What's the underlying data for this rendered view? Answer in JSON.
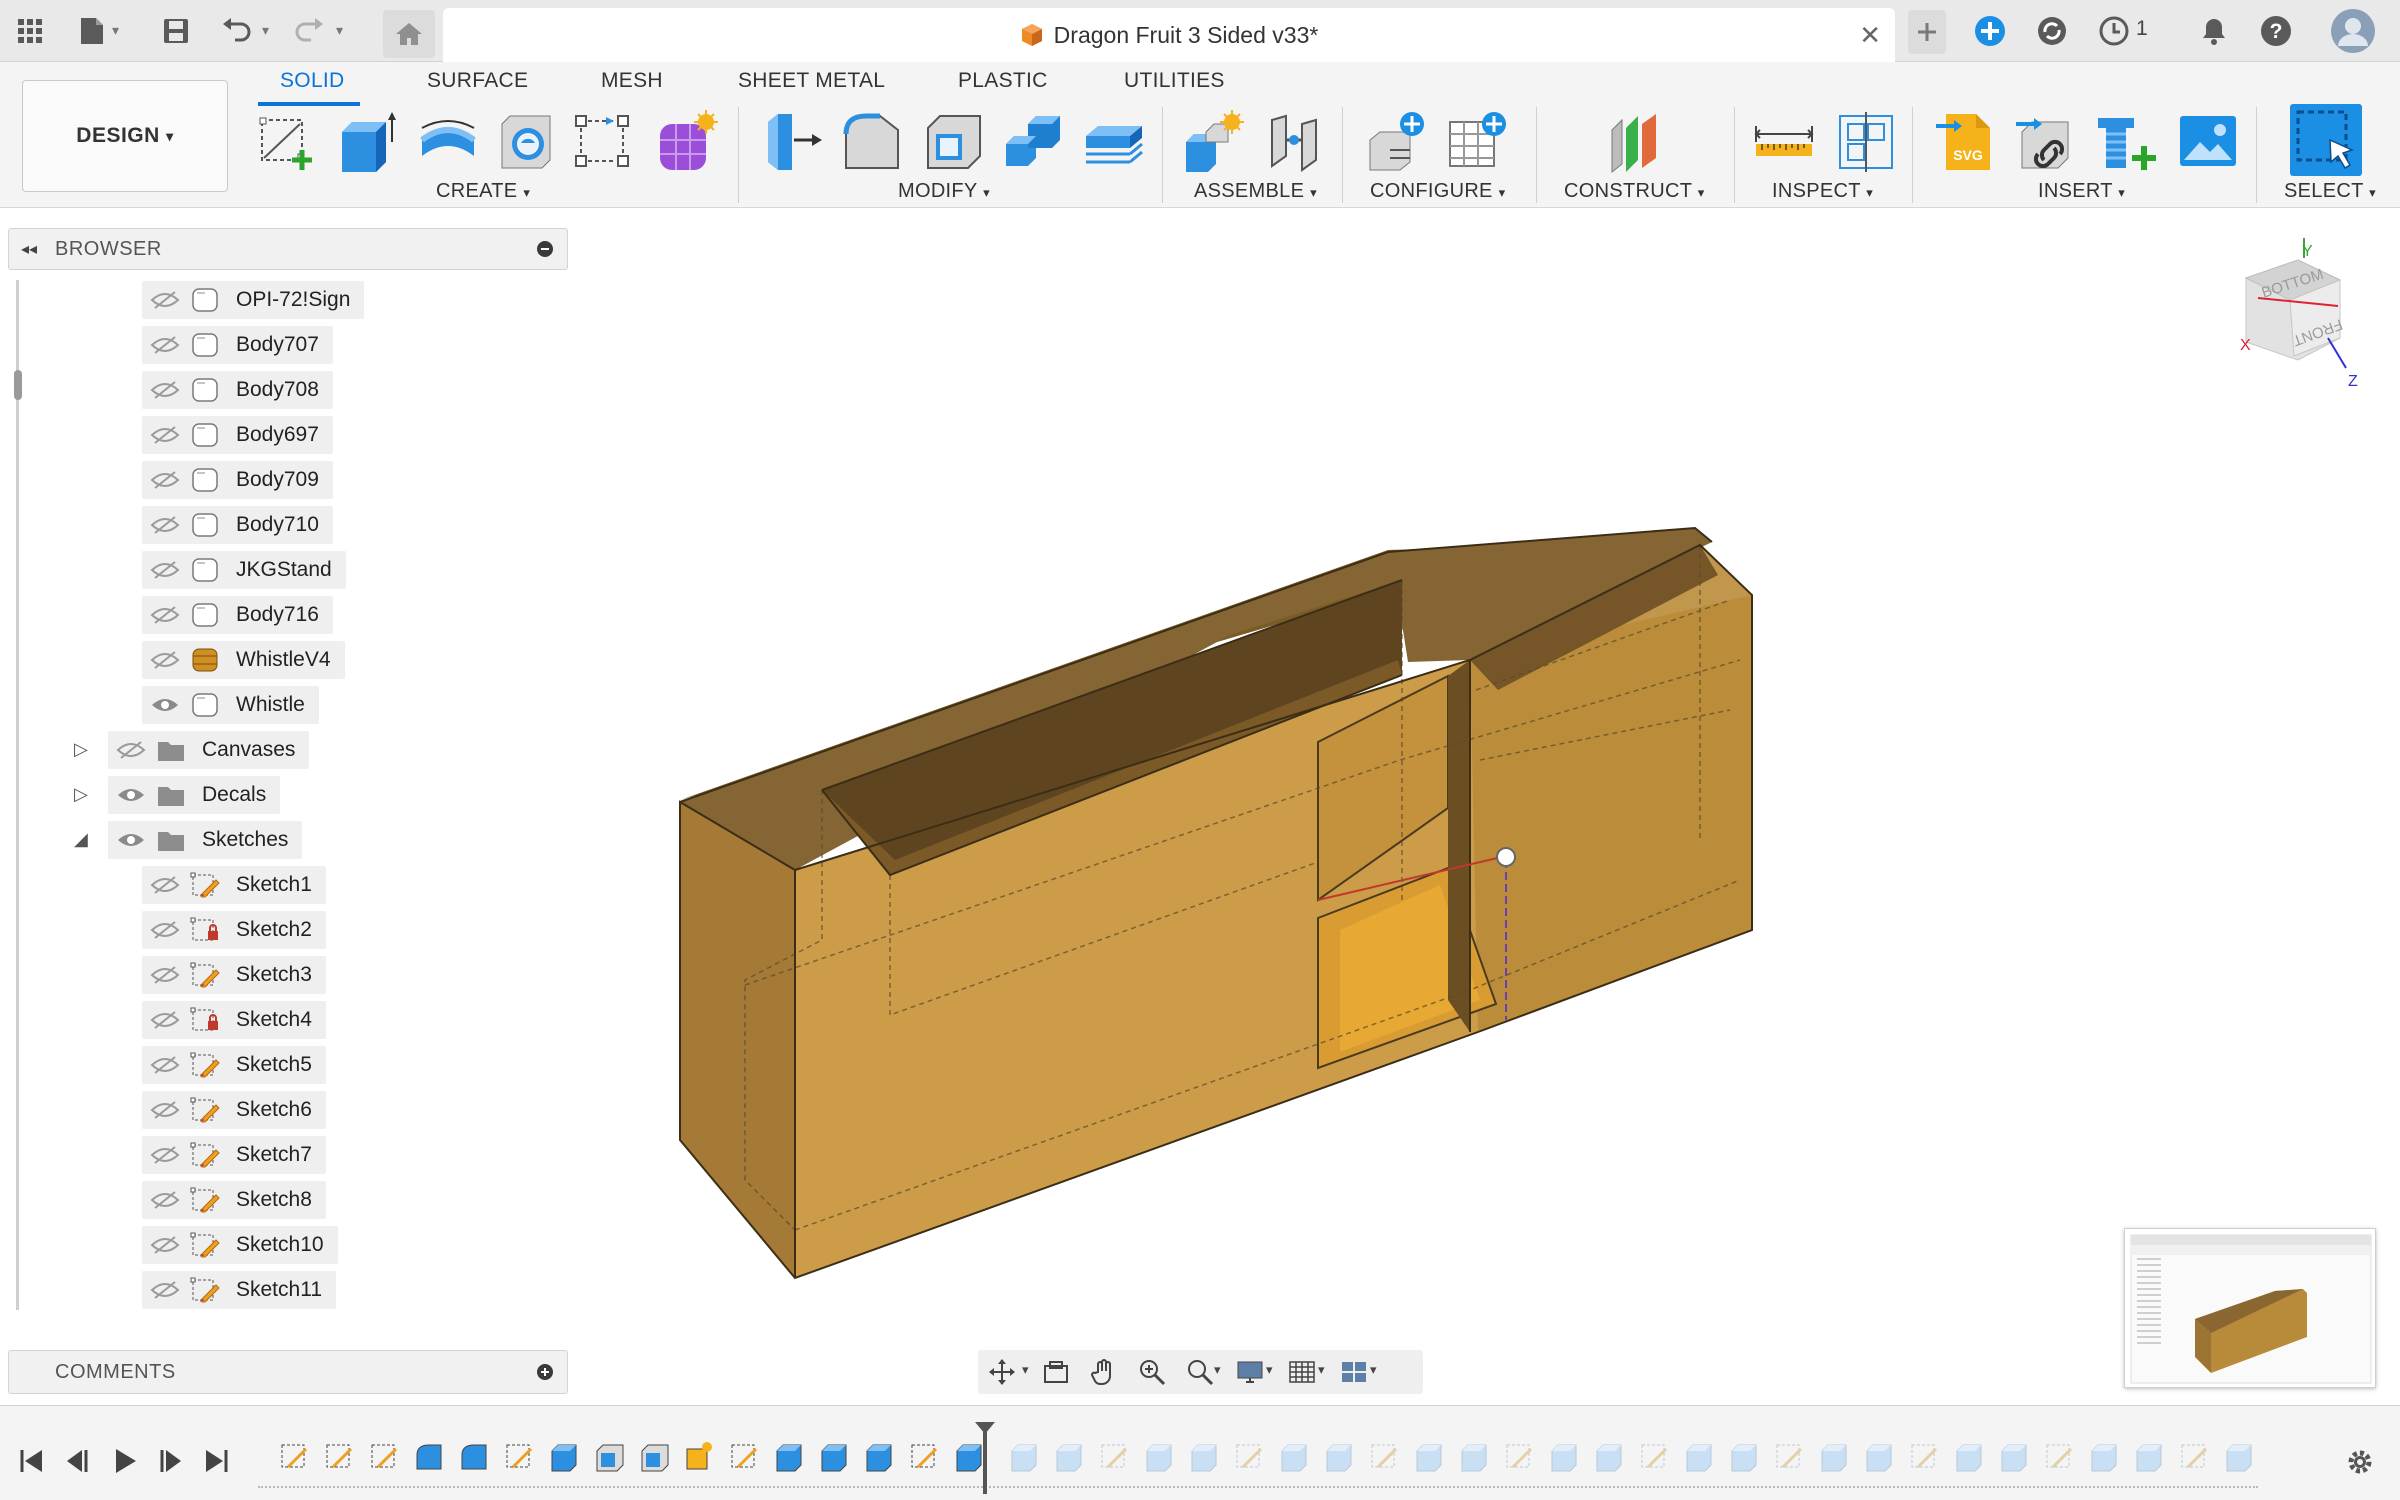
{
  "window": {
    "title": "Dragon Fruit 3 Sided v33*",
    "job_count": "1"
  },
  "toolbar": {
    "workspace": "DESIGN",
    "tabs": [
      {
        "label": "SOLID",
        "active": true
      },
      {
        "label": "SURFACE",
        "active": false
      },
      {
        "label": "MESH",
        "active": false
      },
      {
        "label": "SHEET METAL",
        "active": false
      },
      {
        "label": "PLASTIC",
        "active": false
      },
      {
        "label": "UTILITIES",
        "active": false
      }
    ],
    "groups": {
      "create": "CREATE",
      "modify": "MODIFY",
      "assemble": "ASSEMBLE",
      "configure": "CONFIGURE",
      "construct": "CONSTRUCT",
      "inspect": "INSPECT",
      "insert": "INSERT",
      "select": "SELECT"
    },
    "tools": {
      "create": [
        "create-sketch-icon",
        "extrude-icon",
        "revolve-icon",
        "hole-icon",
        "pattern-icon",
        "create-form-icon"
      ],
      "modify": [
        "press-pull-icon",
        "fillet-icon",
        "shell-icon",
        "combine-icon",
        "offset-face-icon"
      ],
      "assemble": [
        "new-component-icon",
        "joint-icon"
      ],
      "configure": [
        "configure-rule-icon",
        "configure-table-icon"
      ],
      "construct": [
        "offset-plane-icon"
      ],
      "inspect": [
        "measure-icon",
        "section-analysis-icon"
      ],
      "insert": [
        "insert-svg-icon",
        "insert-derive-icon",
        "insert-mcmaster-icon",
        "insert-canvas-icon"
      ],
      "select": [
        "select-window-icon"
      ]
    }
  },
  "browser": {
    "title": "BROWSER",
    "bodies": [
      {
        "name": "OPI-72!Sign",
        "visible": false
      },
      {
        "name": "Body707",
        "visible": false
      },
      {
        "name": "Body708",
        "visible": false
      },
      {
        "name": "Body697",
        "visible": false
      },
      {
        "name": "Body709",
        "visible": false
      },
      {
        "name": "Body710",
        "visible": false
      },
      {
        "name": "JKGStand",
        "visible": false
      },
      {
        "name": "Body716",
        "visible": false
      },
      {
        "name": "WhistleV4",
        "visible": false
      },
      {
        "name": "Whistle",
        "visible": true
      }
    ],
    "folders": [
      {
        "name": "Canvases",
        "visible": false,
        "expanded": false
      },
      {
        "name": "Decals",
        "visible": true,
        "expanded": false
      },
      {
        "name": "Sketches",
        "visible": true,
        "expanded": true
      }
    ],
    "sketches": [
      {
        "name": "Sketch1",
        "locked": false
      },
      {
        "name": "Sketch2",
        "locked": true
      },
      {
        "name": "Sketch3",
        "locked": false
      },
      {
        "name": "Sketch4",
        "locked": true
      },
      {
        "name": "Sketch5",
        "locked": false
      },
      {
        "name": "Sketch6",
        "locked": false
      },
      {
        "name": "Sketch7",
        "locked": false
      },
      {
        "name": "Sketch8",
        "locked": false
      },
      {
        "name": "Sketch10",
        "locked": false
      },
      {
        "name": "Sketch11",
        "locked": false
      }
    ]
  },
  "comments": {
    "title": "COMMENTS"
  },
  "viewcube": {
    "faces": [
      "BOTTOM",
      "FRONT"
    ],
    "axes": [
      "Y",
      "X",
      "Z"
    ]
  },
  "colors": {
    "accent": "#0b74d6",
    "body": "#c99a3e",
    "body_dark": "#8a6a30",
    "toolbar_bg": "#f4f4f4"
  },
  "timeline": {
    "controls": [
      "go-to-start-icon",
      "step-back-icon",
      "play-icon",
      "step-forward-icon",
      "go-to-end-icon"
    ],
    "feature_count": 44,
    "active_features": 16
  }
}
